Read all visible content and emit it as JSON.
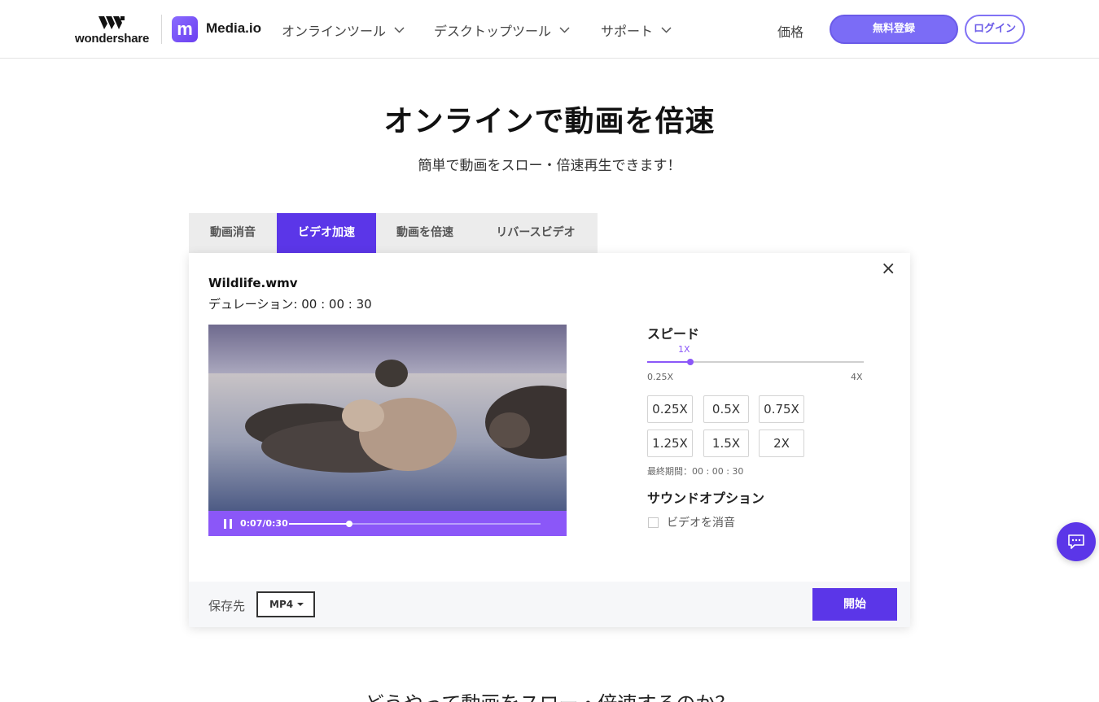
{
  "header": {
    "wondershare_logo_text": "wondershare",
    "mediaio_icon_letter": "m",
    "mediaio_name": "Media.io",
    "nav": [
      {
        "label": "オンラインツール"
      },
      {
        "label": "デスクトップツール"
      },
      {
        "label": "サポート"
      }
    ],
    "price_label": "価格",
    "signup_label": "無料登録",
    "login_label": "ログイン"
  },
  "hero": {
    "title": "オンラインで動画を倍速",
    "subtitle": "簡単で動画をスロー・倍速再生できます！"
  },
  "tabs": [
    {
      "label": "動画消音",
      "active": false
    },
    {
      "label": "ビデオ加速",
      "active": true
    },
    {
      "label": "動画を倍速",
      "active": false
    },
    {
      "label": "リバースビデオ",
      "active": false
    }
  ],
  "editor": {
    "file_name": "Wildlife.wmv",
    "duration_text": "デュレーション: 00 : 00 : 30",
    "player": {
      "time_text": "0:07/0:30",
      "progress": 0.24
    },
    "speed": {
      "title": "スピード",
      "current_label": "1X",
      "slider_value": 0.2,
      "min_label": "0.25X",
      "max_label": "4X",
      "options": [
        "0.25X",
        "0.5X",
        "0.75X",
        "1.25X",
        "1.5X",
        "2X"
      ]
    },
    "final_duration": "最終期間：00 : 00 : 30",
    "sound": {
      "title": "サウンドオプション",
      "mute_label": "ビデオを消音",
      "mute_checked": false
    },
    "footer": {
      "save_label": "保存先",
      "format_value": "MP4",
      "start_label": "開始"
    }
  },
  "bottom_heading": "どうやって動画をスロー・倍速するのか？",
  "colors": {
    "accent": "#5b36e8",
    "player_bar": "#8b57f8",
    "signup": "#7b6cf6"
  }
}
